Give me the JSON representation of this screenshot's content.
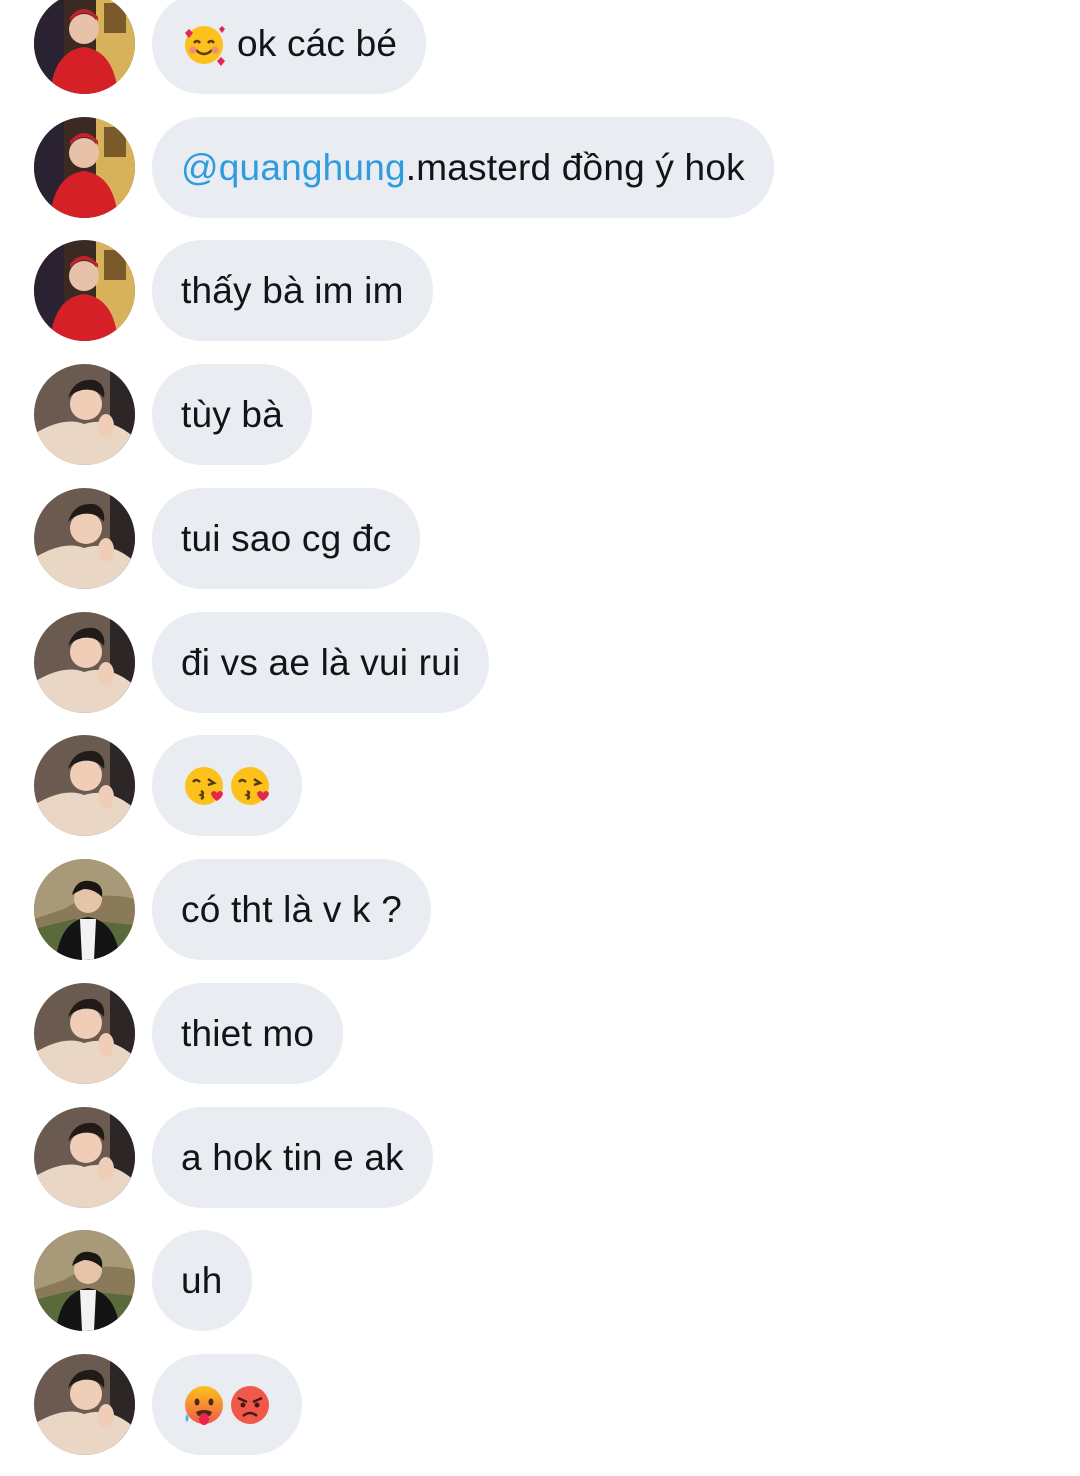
{
  "thread": {
    "messages": [
      {
        "sender": "a",
        "avatar": "avatar-red-jacket",
        "emojis": [
          "smiling-face-with-hearts"
        ],
        "text": "ok các bé"
      },
      {
        "sender": "a",
        "avatar": "avatar-red-jacket",
        "mention": "@quanghung",
        "text": ".masterd đồng ý hok"
      },
      {
        "sender": "a",
        "avatar": "avatar-red-jacket",
        "text": "thấy bà im im"
      },
      {
        "sender": "b",
        "avatar": "avatar-beige-sweater",
        "text": "tùy bà"
      },
      {
        "sender": "b",
        "avatar": "avatar-beige-sweater",
        "text": "tui sao cg đc"
      },
      {
        "sender": "b",
        "avatar": "avatar-beige-sweater",
        "text": "đi vs ae là vui rui"
      },
      {
        "sender": "b",
        "avatar": "avatar-beige-sweater",
        "emojis": [
          "face-blowing-kiss",
          "face-blowing-kiss"
        ]
      },
      {
        "sender": "c",
        "avatar": "avatar-black-jacket",
        "text": "có tht là v k ?"
      },
      {
        "sender": "b",
        "avatar": "avatar-beige-sweater",
        "text": "thiet mo"
      },
      {
        "sender": "b",
        "avatar": "avatar-beige-sweater",
        "text": "a hok tin e ak"
      },
      {
        "sender": "c",
        "avatar": "avatar-black-jacket",
        "text": "uh"
      },
      {
        "sender": "b",
        "avatar": "avatar-beige-sweater",
        "emojis": [
          "hot-face",
          "angry-face"
        ]
      }
    ]
  },
  "colors": {
    "bubble_background": "#e9ecf0",
    "text": "#111418",
    "mention": "#2f9be0"
  }
}
